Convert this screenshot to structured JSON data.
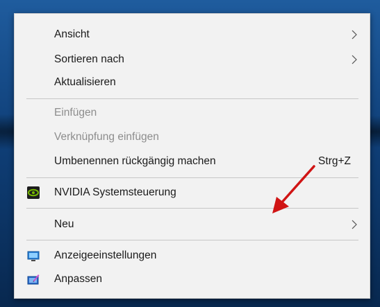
{
  "context_menu": {
    "items": [
      {
        "label": "Ansicht",
        "submenu": true
      },
      {
        "label": "Sortieren nach",
        "submenu": true
      },
      {
        "label": "Aktualisieren"
      },
      {
        "label": "Einfügen",
        "disabled": true
      },
      {
        "label": "Verknüpfung einfügen",
        "disabled": true
      },
      {
        "label": "Umbenennen rückgängig machen",
        "shortcut": "Strg+Z"
      },
      {
        "label": "NVIDIA Systemsteuerung",
        "icon": "nvidia-icon"
      },
      {
        "label": "Neu",
        "submenu": true
      },
      {
        "label": "Anzeigeeinstellungen",
        "icon": "display-settings-icon"
      },
      {
        "label": "Anpassen",
        "icon": "personalize-icon"
      }
    ]
  },
  "colors": {
    "menu_background": "#f2f2f2",
    "disabled_text": "#8d8d8d",
    "annotation_arrow": "#d01414",
    "desktop_background": "#0f3f78"
  }
}
